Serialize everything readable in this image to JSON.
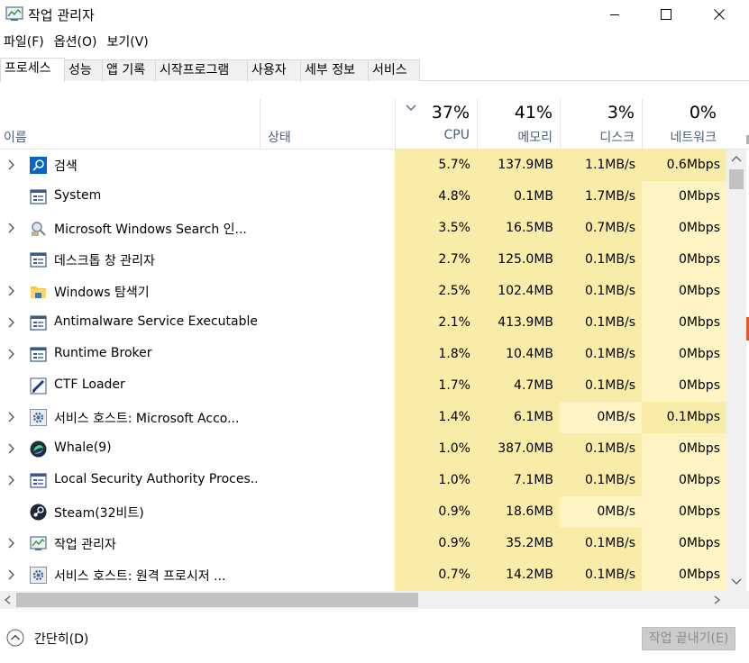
{
  "window": {
    "title": "작업 관리자"
  },
  "menu": [
    "파일(F)",
    "옵션(O)",
    "보기(V)"
  ],
  "tabs": [
    "프로세스",
    "성능",
    "앱 기록",
    "시작프로그램",
    "사용자",
    "세부 정보",
    "서비스"
  ],
  "columns": {
    "name": "이름",
    "status": "상태",
    "cpu": {
      "pct": "37%",
      "label": "CPU"
    },
    "memory": {
      "pct": "41%",
      "label": "메모리"
    },
    "disk": {
      "pct": "3%",
      "label": "디스크"
    },
    "network": {
      "pct": "0%",
      "label": "네트워크"
    }
  },
  "colors": {
    "heat_light": "#fff4c4",
    "heat_mid": "#f9eca8",
    "header_text": "#4c607a",
    "end_task_bg": "#cccccc"
  },
  "processes": [
    {
      "name": "검색",
      "icon": "search-icon",
      "expandable": true,
      "cpu": "5.7%",
      "memory": "137.9MB",
      "disk": "1.1MB/s",
      "network": "0.6Mbps"
    },
    {
      "name": "System",
      "icon": "window-icon",
      "expandable": false,
      "cpu": "4.8%",
      "memory": "0.1MB",
      "disk": "1.7MB/s",
      "network": "0Mbps"
    },
    {
      "name": "Microsoft Windows Search 인...",
      "icon": "search-indexer-icon",
      "expandable": true,
      "cpu": "3.5%",
      "memory": "16.5MB",
      "disk": "0.7MB/s",
      "network": "0Mbps"
    },
    {
      "name": "데스크톱 창 관리자",
      "icon": "window-icon",
      "expandable": false,
      "cpu": "2.7%",
      "memory": "125.0MB",
      "disk": "0.1MB/s",
      "network": "0Mbps"
    },
    {
      "name": "Windows 탐색기",
      "icon": "folder-icon",
      "expandable": true,
      "cpu": "2.5%",
      "memory": "102.4MB",
      "disk": "0.1MB/s",
      "network": "0Mbps"
    },
    {
      "name": "Antimalware Service Executable",
      "icon": "window-icon",
      "expandable": true,
      "cpu": "2.1%",
      "memory": "413.9MB",
      "disk": "0.1MB/s",
      "network": "0Mbps"
    },
    {
      "name": "Runtime Broker",
      "icon": "window-icon",
      "expandable": true,
      "cpu": "1.8%",
      "memory": "10.4MB",
      "disk": "0.1MB/s",
      "network": "0Mbps"
    },
    {
      "name": "CTF Loader",
      "icon": "pen-icon",
      "expandable": false,
      "cpu": "1.7%",
      "memory": "4.7MB",
      "disk": "0.1MB/s",
      "network": "0Mbps"
    },
    {
      "name": "서비스 호스트: Microsoft Acco...",
      "icon": "gear-icon",
      "expandable": true,
      "cpu": "1.4%",
      "memory": "6.1MB",
      "disk": "0MB/s",
      "network": "0.1Mbps"
    },
    {
      "name": "Whale(9)",
      "icon": "whale-icon",
      "expandable": true,
      "cpu": "1.0%",
      "memory": "387.0MB",
      "disk": "0.1MB/s",
      "network": "0Mbps"
    },
    {
      "name": "Local Security Authority Proces...",
      "icon": "window-icon",
      "expandable": true,
      "cpu": "1.0%",
      "memory": "7.1MB",
      "disk": "0.1MB/s",
      "network": "0Mbps"
    },
    {
      "name": "Steam(32비트)",
      "icon": "steam-icon",
      "expandable": false,
      "cpu": "0.9%",
      "memory": "18.6MB",
      "disk": "0MB/s",
      "network": "0Mbps"
    },
    {
      "name": "작업 관리자",
      "icon": "task-manager-icon",
      "expandable": true,
      "cpu": "0.9%",
      "memory": "35.2MB",
      "disk": "0.1MB/s",
      "network": "0Mbps"
    },
    {
      "name": "서비스 호스트: 원격 프로시저 ...",
      "icon": "gear-icon",
      "expandable": true,
      "cpu": "0.7%",
      "memory": "14.2MB",
      "disk": "0.1MB/s",
      "network": "0Mbps"
    }
  ],
  "footer": {
    "fewer_details": "간단히(D)",
    "end_task": "작업 끝내기(E)"
  }
}
